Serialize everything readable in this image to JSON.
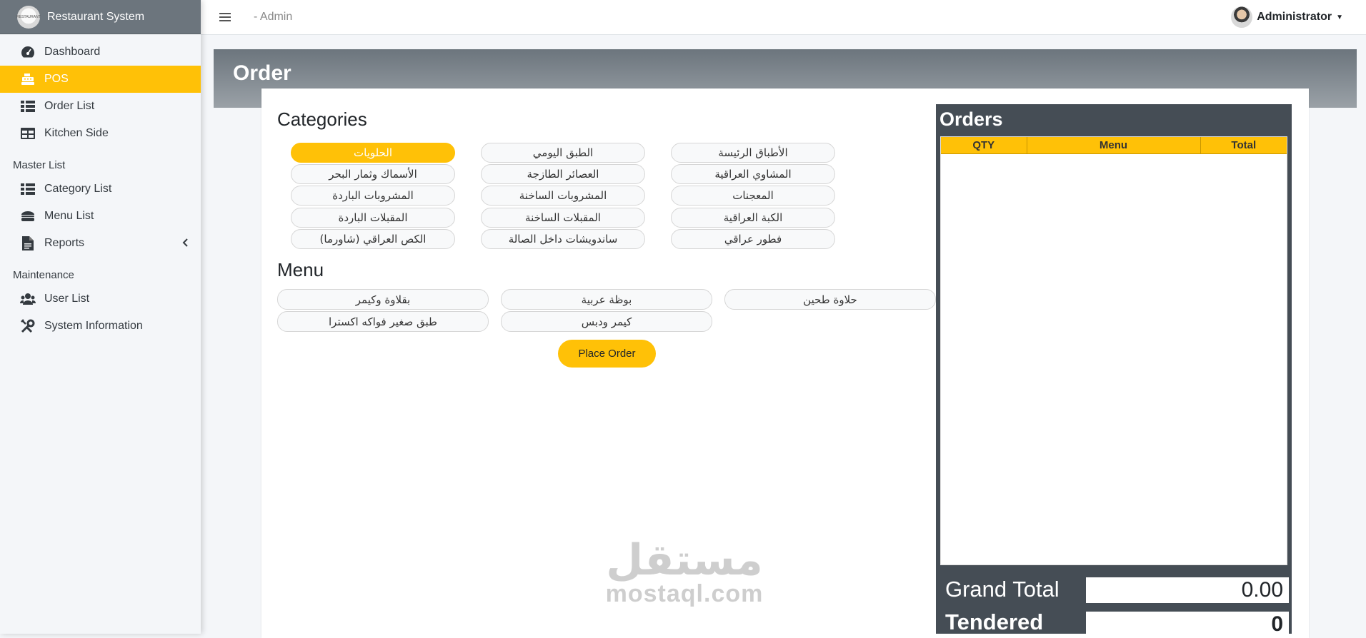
{
  "sidebar": {
    "brand": "Restaurant System",
    "logo_text": "RESTAURANT",
    "items": [
      {
        "label": "Dashboard",
        "icon": "dashboard-icon",
        "active": false
      },
      {
        "label": "POS",
        "icon": "cash-register-icon",
        "active": true
      },
      {
        "label": "Order List",
        "icon": "list-icon",
        "active": false
      },
      {
        "label": "Kitchen Side",
        "icon": "table-icon",
        "active": false
      }
    ],
    "master_header": "Master List",
    "master_items": [
      {
        "label": "Category List",
        "icon": "list-icon"
      },
      {
        "label": "Menu List",
        "icon": "hamburger-food-icon"
      },
      {
        "label": "Reports",
        "icon": "document-icon"
      }
    ],
    "maintenance_header": "Maintenance",
    "maintenance_items": [
      {
        "label": "User List",
        "icon": "users-icon"
      },
      {
        "label": "System Information",
        "icon": "tools-icon"
      }
    ]
  },
  "topbar": {
    "admin_label": "- Admin",
    "user_name": "Administrator"
  },
  "page": {
    "title": "Order",
    "categories_title": "Categories",
    "menu_title": "Menu",
    "place_order": "Place Order"
  },
  "categories": [
    "الحلويات",
    "الطبق اليومي",
    "الأطباق الرئيسة",
    "الأسماك وثمار البحر",
    "العصائر الطازجة",
    "المشاوي العراقية",
    "المشروبات الباردة",
    "المشروبات الساخنة",
    "المعجنات",
    "المقبلات الباردة",
    "المقبلات الساخنة",
    "الكبة العراقية",
    "الكص العراقي (شاورما)",
    "ساندويشات داخل الصالة",
    "فطور عراقي"
  ],
  "selected_category": "الحلويات",
  "menu_items": [
    "بقلاوة وكيمر",
    "بوظة عربية",
    "حلاوة طحين",
    "طبق صغير فواكه اكسترا",
    "كيمر ودبس"
  ],
  "orders": {
    "title": "Orders",
    "columns": [
      "QTY",
      "Menu",
      "Total"
    ],
    "rows": [],
    "grand_total_label": "Grand Total",
    "grand_total_value": "0.00",
    "tendered_label": "Tendered",
    "tendered_value": "0"
  },
  "watermark": {
    "arabic": "مستقل",
    "latin": "mostaql.com"
  },
  "colors": {
    "accent": "#ffc107",
    "brand_bar": "#6c757d",
    "orders_panel": "#454d55"
  }
}
